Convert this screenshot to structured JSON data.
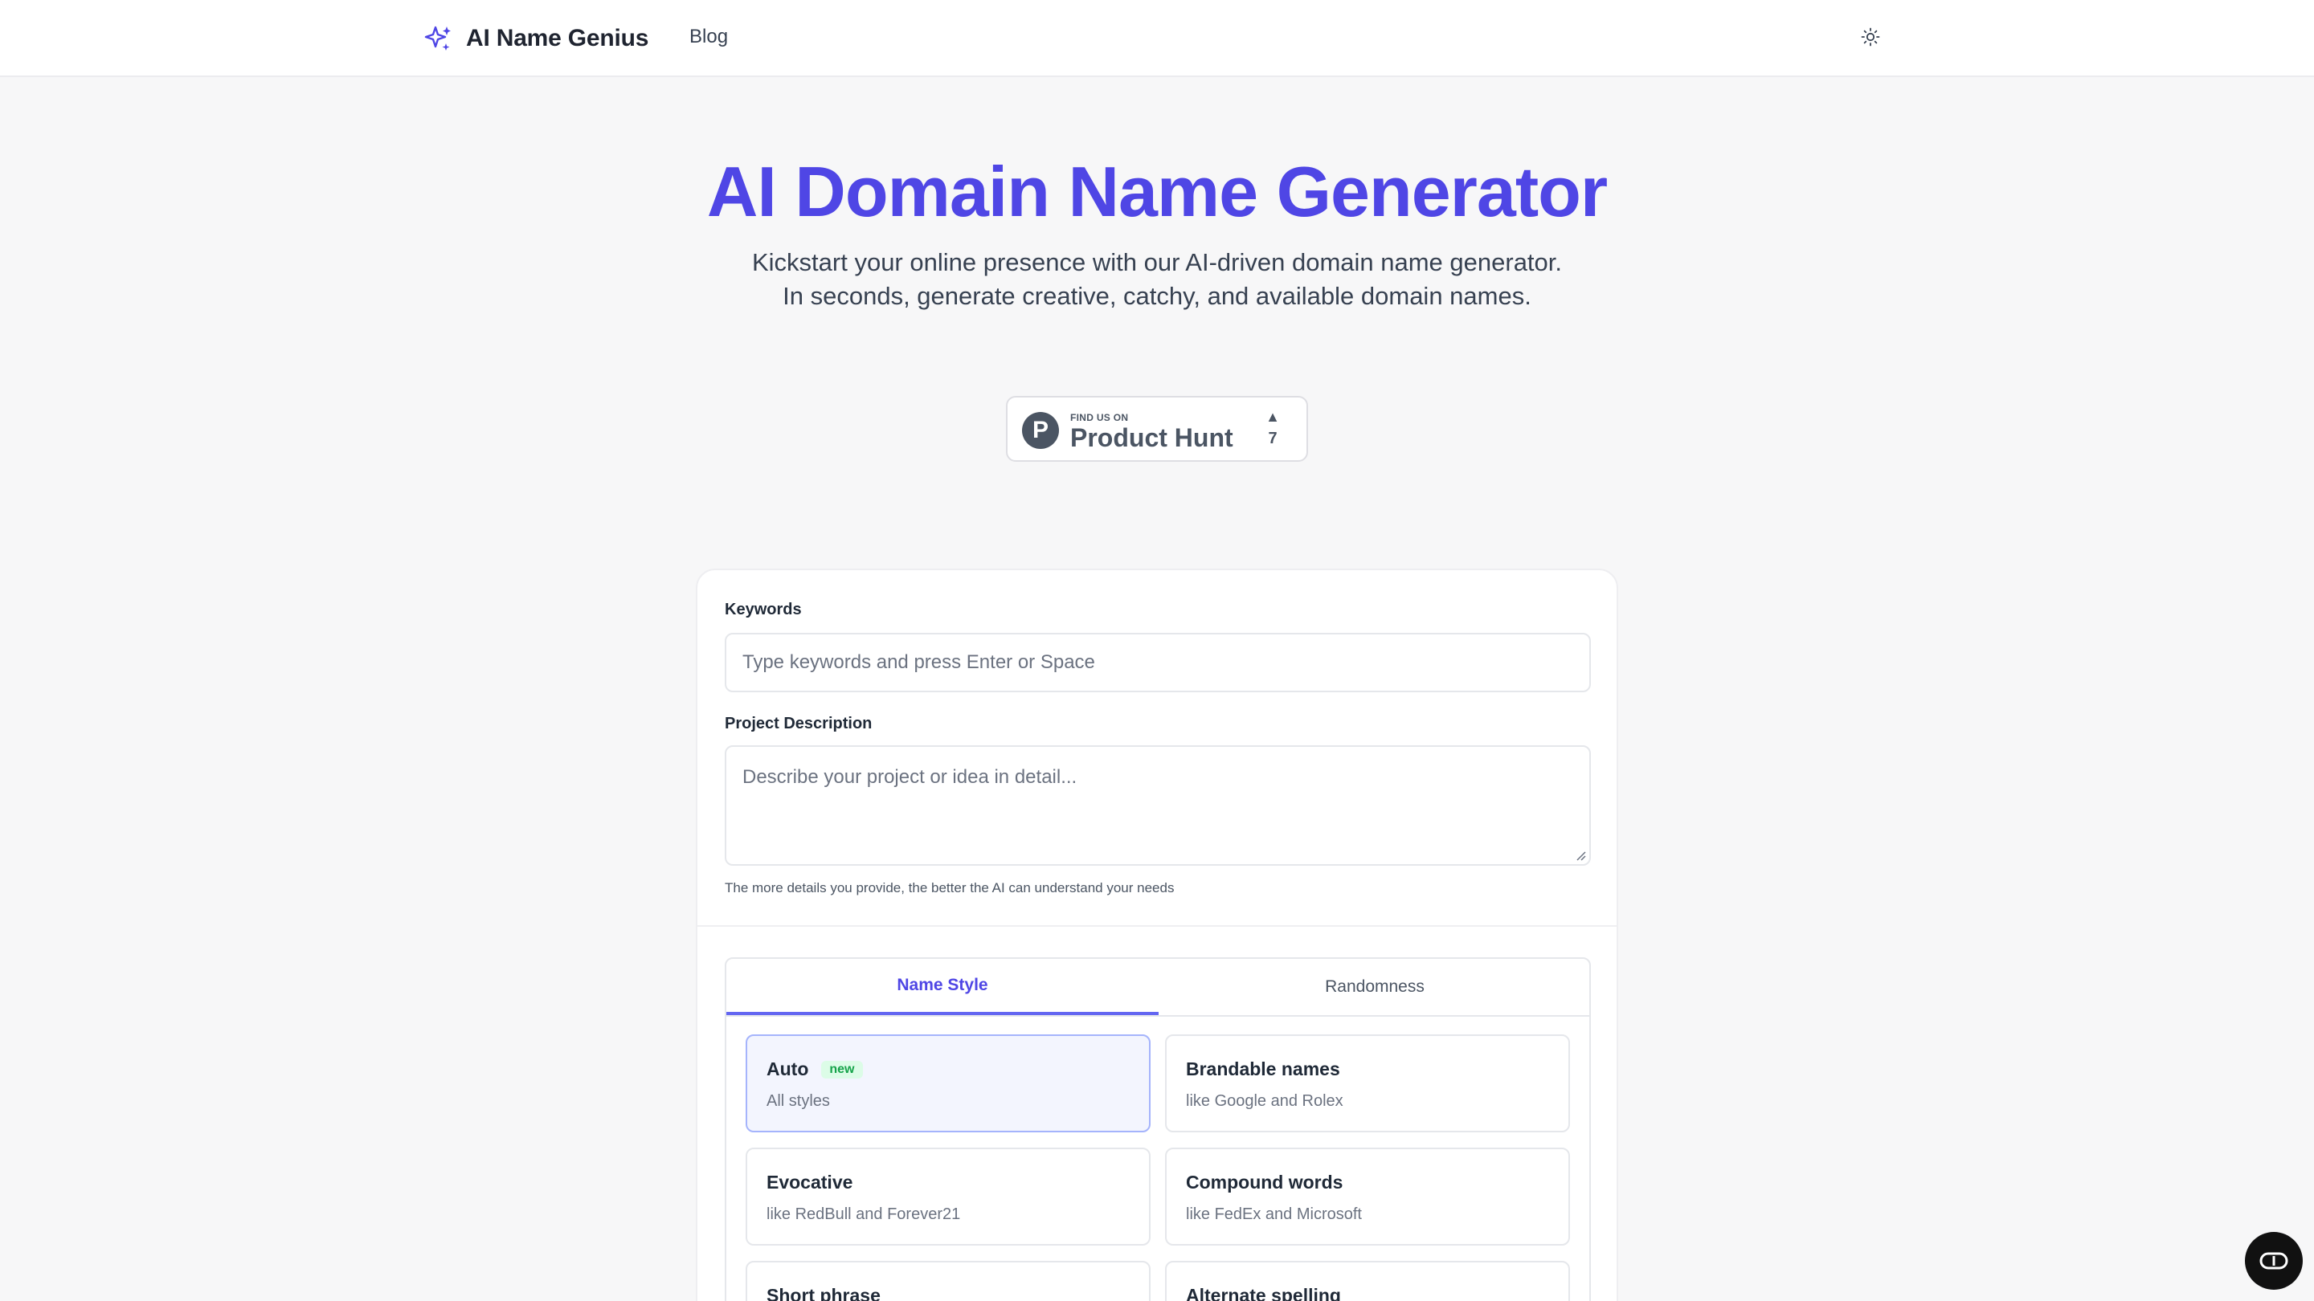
{
  "header": {
    "brand_name": "AI Name Genius",
    "brand_icon": "sparkles-icon",
    "nav_blog": "Blog",
    "theme_icon": "sun-icon"
  },
  "hero": {
    "title": "AI Domain Name Generator",
    "subtitle": "Kickstart your online presence with our AI-driven domain name generator. In seconds, generate creative, catchy, and available domain names."
  },
  "product_hunt": {
    "small_text": "FIND US ON",
    "name": "Product Hunt",
    "logo_letter": "P",
    "upvote_arrow": "▲",
    "count": "7"
  },
  "form": {
    "keywords_label": "Keywords",
    "keywords_placeholder": "Type keywords and press Enter or Space",
    "description_label": "Project Description",
    "description_placeholder": "Describe your project or idea in detail...",
    "hint": "The more details you provide, the better the AI can understand your needs"
  },
  "tabs": [
    {
      "label": "Name Style",
      "active": true
    },
    {
      "label": "Randomness",
      "active": false
    }
  ],
  "styles": [
    {
      "title": "Auto",
      "badge": "new",
      "subtitle": "All styles",
      "selected": true
    },
    {
      "title": "Brandable names",
      "subtitle": "like Google and Rolex",
      "selected": false
    },
    {
      "title": "Evocative",
      "subtitle": "like RedBull and Forever21",
      "selected": false
    },
    {
      "title": "Compound words",
      "subtitle": "like FedEx and Microsoft",
      "selected": false
    },
    {
      "title": "Short phrase",
      "subtitle": "",
      "selected": false
    },
    {
      "title": "Alternate spelling",
      "subtitle": "",
      "selected": false
    }
  ],
  "colors": {
    "accent": "#4f46e5",
    "new_badge_text": "#16a34a",
    "new_badge_bg": "#dcfce7",
    "selected_bg": "#f3f5fe"
  },
  "chat_icon": "chat-bubble-icon"
}
